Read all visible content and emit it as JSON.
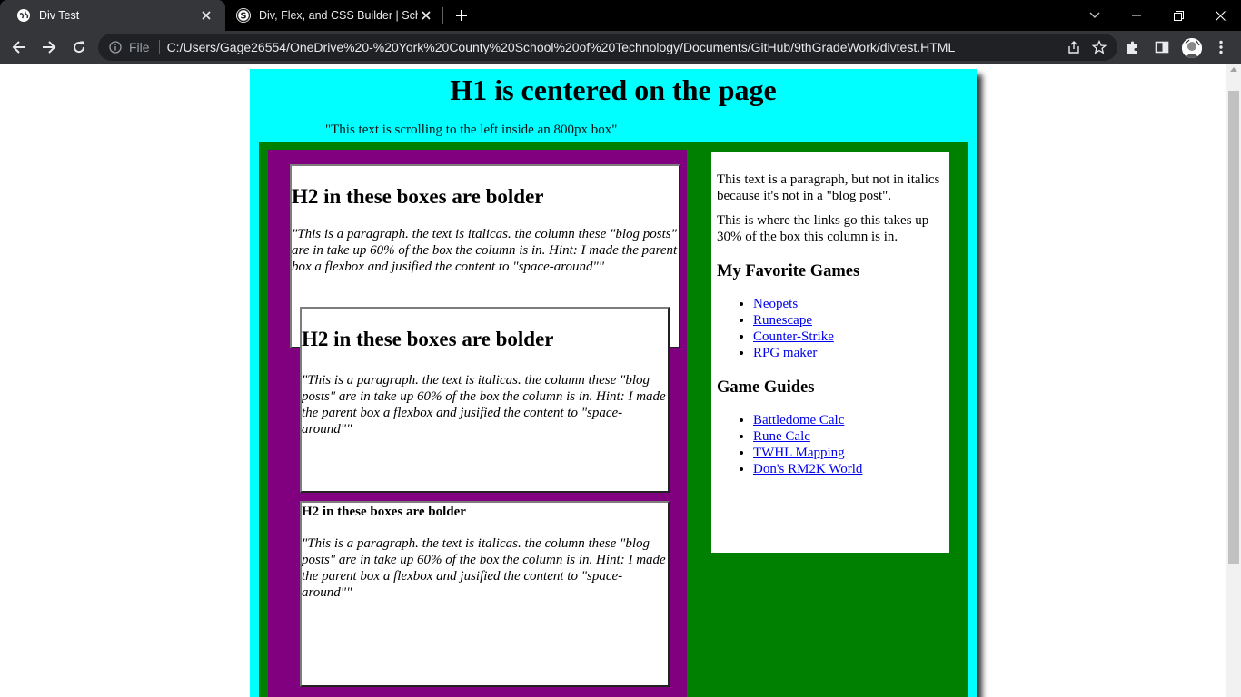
{
  "browser": {
    "tabs": [
      {
        "title": "Div Test",
        "active": true,
        "favicon": "globe-icon"
      },
      {
        "title": "Div, Flex, and CSS Builder | School",
        "active": false,
        "favicon": "s-logo-icon"
      }
    ],
    "address": {
      "scheme_label": "File",
      "url": "C:/Users/Gage26554/OneDrive%20-%20York%20County%20School%20of%20Technology/Documents/GitHub/9thGradeWork/divtest.HTML"
    }
  },
  "page": {
    "h1": "H1 is centered on the page",
    "marquee": "\"This text is scrolling to the left inside an 800px box\"",
    "posts": [
      {
        "heading": "H2 in these boxes are bolder",
        "body": "\"This is a paragraph. the text is italicas. the column these \"blog posts\" are in take up 60% of the box the column is in. Hint: I made the parent box a flexbox and jusified the content to \"space-around\"\""
      },
      {
        "heading": "H2 in these boxes are bolder",
        "body": "\"This is a paragraph. the text is italicas. the column these \"blog posts\" are in take up 60% of the box the column is in. Hint: I made the parent box a flexbox and jusified the content to \"space-around\"\""
      },
      {
        "heading": "H2 in these boxes are bolder",
        "body": "\"This is a paragraph. the text is italicas. the column these \"blog posts\" are in take up 60% of the box the column is in. Hint: I made the parent box a flexbox and jusified the content to \"space-around\"\""
      }
    ],
    "sidebar": {
      "para1": "This text is a paragraph, but not in italics because it's not in a \"blog post\".",
      "para2": "This is where the links go this takes up 30% of the box this column is in.",
      "games_heading": "My Favorite Games",
      "games": [
        "Neopets",
        "Runescape",
        "Counter-Strike",
        "RPG maker"
      ],
      "guides_heading": "Game Guides",
      "guides": [
        "Battledome Calc",
        "Rune Calc",
        "TWHL Mapping",
        "Don's RM2K World"
      ]
    }
  },
  "colors": {
    "wrapper": "#00ffff",
    "main_column": "#008000",
    "posts_column": "#800080",
    "link": "#0000ee",
    "chrome_tabbar": "#000000",
    "chrome_toolbar": "#35363a"
  }
}
